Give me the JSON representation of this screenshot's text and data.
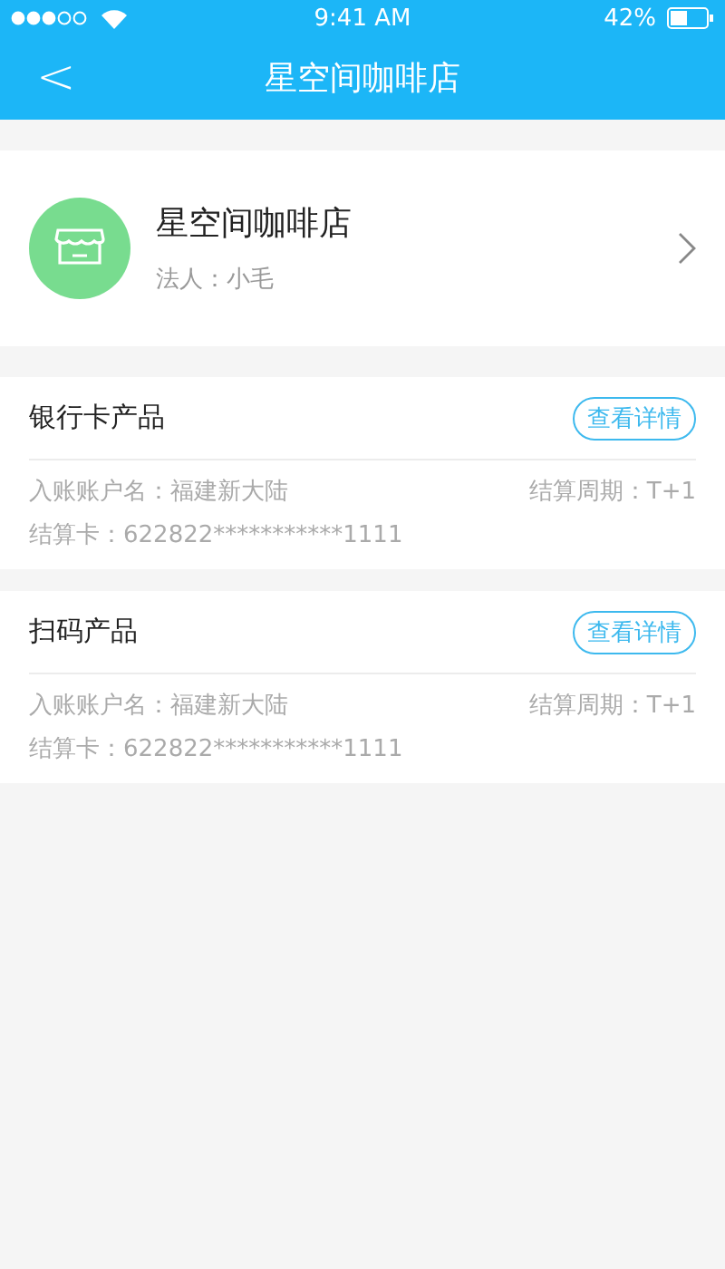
{
  "status_bar": {
    "time": "9:41 AM",
    "battery": "42%"
  },
  "nav": {
    "back": "<",
    "title": "星空间咖啡店"
  },
  "merchant": {
    "name": "星空间咖啡店",
    "legal": "法人：小毛"
  },
  "products": [
    {
      "title": "银行卡产品",
      "button": "查看详情",
      "account": "入账账户名：福建新大陆",
      "cycle": "结算周期：T+1",
      "card": "结算卡：622822***********1111"
    },
    {
      "title": "扫码产品",
      "button": "查看详情",
      "account": "入账账户名：福建新大陆",
      "cycle": "结算周期：T+1",
      "card": "结算卡：622822***********1111"
    }
  ]
}
